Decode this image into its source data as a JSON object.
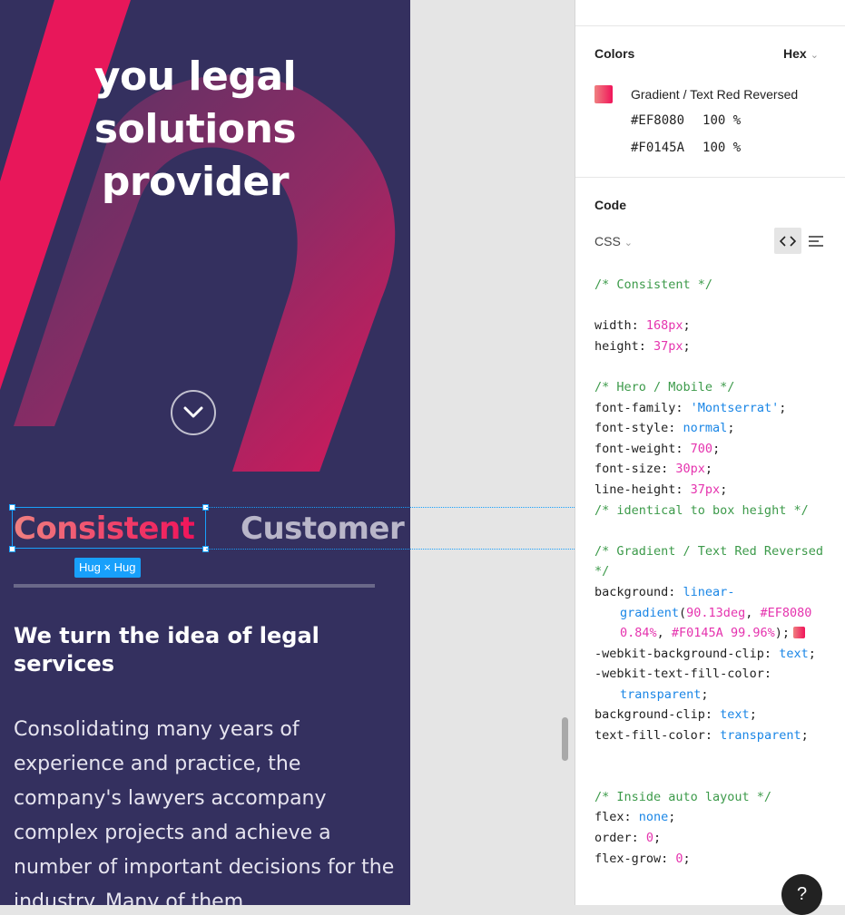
{
  "mobile_frame": {
    "hero_title_lines": [
      "you legal",
      "solutions",
      "provider"
    ],
    "tabs": [
      {
        "label": "Consistent",
        "active": true
      },
      {
        "label": "Customer",
        "active": false
      }
    ],
    "selection_label": "Hug × Hug",
    "section_heading": "We turn the idea of legal services",
    "section_body": "Consolidating many years of experience and practice, the company's lawyers accompany complex projects and achieve a number of important decisions for the industry. Many of them"
  },
  "inspect_panel": {
    "colors": {
      "title": "Colors",
      "format": "Hex",
      "style_name": "Gradient / Text Red Reversed",
      "stops": [
        {
          "hex": "#EF8080",
          "opacity": "100 %"
        },
        {
          "hex": "#F0145A",
          "opacity": "100 %"
        }
      ]
    },
    "code": {
      "title": "Code",
      "language": "CSS",
      "lines": [
        "/* Consistent */",
        "",
        "width: 168px;",
        "height: 37px;",
        "",
        "/* Hero / Mobile */",
        "font-family: 'Montserrat';",
        "font-style: normal;",
        "font-weight: 700;",
        "font-size: 30px;",
        "line-height: 37px;",
        "/* identical to box height */",
        "",
        "/* Gradient / Text Red Reversed",
        "*/",
        "background: linear-",
        "gradient(90.13deg, #EF8080",
        "0.84%, #F0145A 99.96%);",
        "-webkit-background-clip: text;",
        "-webkit-text-fill-color:",
        "transparent;",
        "background-clip: text;",
        "text-fill-color: transparent;",
        "",
        "",
        "/* Inside auto layout */",
        "flex: none;",
        "order: 0;",
        "flex-grow: 0;"
      ]
    },
    "help_label": "?"
  },
  "colors": {
    "frame_bg": "#34305F",
    "accent_pink": "#F0145A",
    "selection_blue": "#18A0FB"
  }
}
